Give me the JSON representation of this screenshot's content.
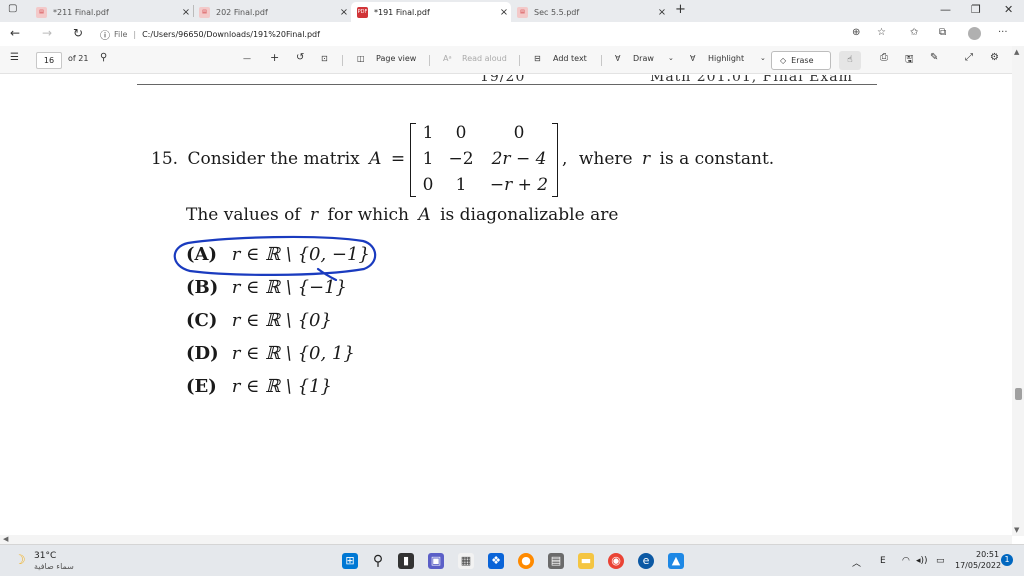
{
  "browser": {
    "tabs": [
      {
        "title": "*211 Final.pdf",
        "close": "×",
        "active": false
      },
      {
        "title": "202 Final.pdf",
        "close": "×",
        "active": false
      },
      {
        "title": "*191 Final.pdf",
        "close": "×",
        "active": true
      },
      {
        "title": "Sec 5.5.pdf",
        "close": "×",
        "active": false
      }
    ],
    "new_tab": "+",
    "window": {
      "minimize": "—",
      "restore": "❐",
      "close": "✕"
    },
    "address": {
      "scheme_label": "File",
      "url": "C:/Users/96650/Downloads/191%20Final.pdf"
    }
  },
  "pdf_toolbar": {
    "page_number": "16",
    "page_total": "of 21",
    "zoom_out": "—",
    "zoom_in": "+",
    "page_view": "Page view",
    "read_aloud": "Read aloud",
    "add_text": "Add text",
    "draw": "Draw",
    "highlight": "Highlight",
    "erase": "Erase"
  },
  "document": {
    "header_left_fragment": "19/20",
    "header_right_fragment": "Math 201.01, Final Exam",
    "question": {
      "number": "15.",
      "intro": "Consider the matrix",
      "var": "A",
      "equals": "=",
      "matrix": [
        [
          "1",
          "0",
          "0"
        ],
        [
          "1",
          "−2",
          "2r − 4"
        ],
        [
          "0",
          "1",
          "−r + 2"
        ]
      ],
      "suffix_comma": ",",
      "suffix_text": "where",
      "suffix_var": "r",
      "suffix_end": "is a constant.",
      "prompt_a": "The values of",
      "prompt_var1": "r",
      "prompt_b": "for which",
      "prompt_var2": "A",
      "prompt_c": "is diagonalizable are"
    },
    "options": [
      {
        "label": "(A)",
        "text": "r ∈ ℝ \\ {0, −1}"
      },
      {
        "label": "(B)",
        "text": "r ∈ ℝ \\ {−1}"
      },
      {
        "label": "(C)",
        "text": "r ∈ ℝ \\ {0}"
      },
      {
        "label": "(D)",
        "text": "r ∈ ℝ \\ {0, 1}"
      },
      {
        "label": "(E)",
        "text": "r ∈ ℝ \\ {1}"
      }
    ],
    "ink_color": "#1a3bbf"
  },
  "taskbar": {
    "weather_temp": "31°C",
    "weather_desc": "سماء صافية",
    "tray_lang": "E",
    "time": "20:51",
    "date": "17/05/2022",
    "notification_count": "1"
  },
  "colors": {
    "pdf_red": "#d13438",
    "edge_blue": "#0c59a4",
    "accent": "#0067c0"
  }
}
